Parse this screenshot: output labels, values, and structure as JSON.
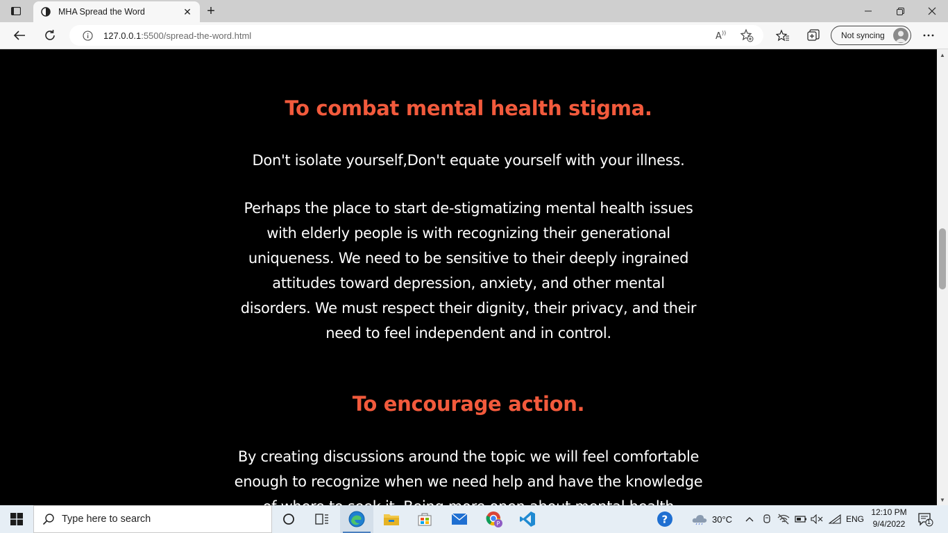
{
  "browser": {
    "tab": {
      "title": "MHA Spread the Word"
    },
    "address": {
      "host": "127.0.0.1",
      "rest": ":5500/spread-the-word.html"
    },
    "sync_label": "Not syncing"
  },
  "page": {
    "section1": {
      "heading": "To combat mental health stigma.",
      "tagline": "Don't isolate yourself,Don't equate yourself with your illness.",
      "lines": [
        "Perhaps the place to start de-stigmatizing mental health issues",
        "with elderly people is with recognizing their generational",
        "uniqueness. We need to be sensitive to their deeply ingrained",
        "attitudes toward depression, anxiety, and other mental",
        "disorders. We must respect their dignity, their privacy, and their",
        "need to feel independent and in control."
      ]
    },
    "section2": {
      "heading": "To encourage action.",
      "lines": [
        "By creating discussions around the topic we will feel comfortable",
        "enough to recognize when we need help and have the knowledge",
        "of where to seek it. Being more open about mental health"
      ]
    }
  },
  "taskbar": {
    "search_placeholder": "Type here to search",
    "weather": "30°C",
    "language": "ENG",
    "time": "12:10 PM",
    "date": "9/4/2022",
    "notification_count": "1"
  },
  "colors": {
    "heading": "#f25a3c",
    "body_text": "#ffffff",
    "page_bg": "#000000"
  }
}
